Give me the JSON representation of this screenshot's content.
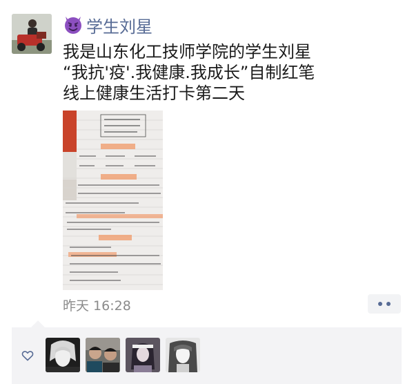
{
  "post": {
    "author": "学生刘星",
    "author_emoji": "smiling-devil-icon",
    "text_lines": [
      "我是山东化工技师学院的学生刘星",
      "“我抗'疫'.我健康.我成长”自制红笔",
      "线上健康生活打卡第二天"
    ],
    "timestamp": "昨天 16:28",
    "more_icon": "more-dots-icon"
  },
  "likes": {
    "icon": "heart-outline-icon",
    "likers": [
      "liker-1",
      "liker-2",
      "liker-3",
      "liker-4"
    ]
  },
  "colors": {
    "name_link": "#576b95",
    "emoji_purple": "#8c4fc0",
    "panel_bg": "#f3f3f5",
    "timestamp": "#8a8a8a"
  }
}
